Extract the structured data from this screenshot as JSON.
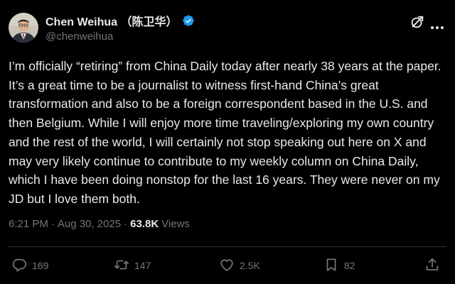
{
  "author": {
    "display_name": "Chen Weihua （陈卫华）",
    "handle": "@chenweihua",
    "verified_icon": "verified-badge-icon",
    "verified_color": "#1d9bf0"
  },
  "tweet": {
    "text": "I’m officially “retiring” from China Daily today after nearly 38 years at the paper. It’s a great time to be a journalist to witness first-hand China’s great transformation and also to be a foreign correspondent based in the U.S. and then Belgium. While I will enjoy more time traveling/exploring my own country and the rest of the world, I will certainly not stop speaking out here on X and may very likely continue to contribute to my weekly column on China Daily, which I have been doing nonstop for the last 16 years. They were never on my JD but I love them both.",
    "time": "6:21 PM",
    "date": "Aug 30, 2025",
    "separator": "·",
    "views_count": "63.8K",
    "views_label": "Views"
  },
  "actions": {
    "reply_count": "169",
    "repost_count": "147",
    "like_count": "2.5K",
    "bookmark_count": "82"
  },
  "colors": {
    "background": "#000000",
    "text": "#e7e9ea",
    "muted": "#71767b",
    "divider": "#2f3336"
  }
}
